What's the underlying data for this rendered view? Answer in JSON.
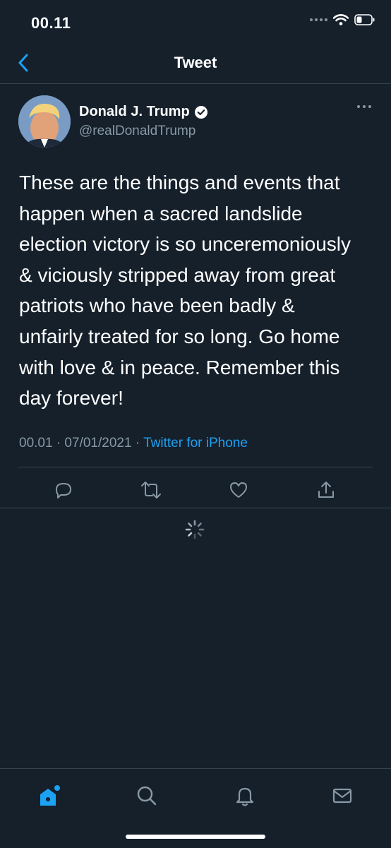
{
  "status_bar": {
    "time": "00.11"
  },
  "nav": {
    "title": "Tweet"
  },
  "tweet": {
    "author_name": "Donald J. Trump",
    "handle": "@realDonaldTrump",
    "text": "These are the things and events that\nhappen when a sacred landslide\nelection victory is so unceremoniously\n& viciously stripped away from great\npatriots who have been badly &\nunfairly treated for so long. Go home\nwith love & in peace. Remember this\nday forever!",
    "timestamp": "00.01 · 07/01/2021 · ",
    "source": "Twitter for iPhone"
  },
  "icons": {
    "back": "chevron-left-icon",
    "verified": "verified-badge-icon",
    "more": "more-horizontal-icon",
    "reply": "reply-icon",
    "retweet": "retweet-icon",
    "like": "heart-icon",
    "share": "share-icon",
    "home": "home-icon",
    "search": "search-icon",
    "notifications": "bell-icon",
    "messages": "mail-icon"
  },
  "colors": {
    "background": "#15202b",
    "accent": "#1da1f2",
    "secondary_text": "#8899a6",
    "divider": "#38444d"
  }
}
